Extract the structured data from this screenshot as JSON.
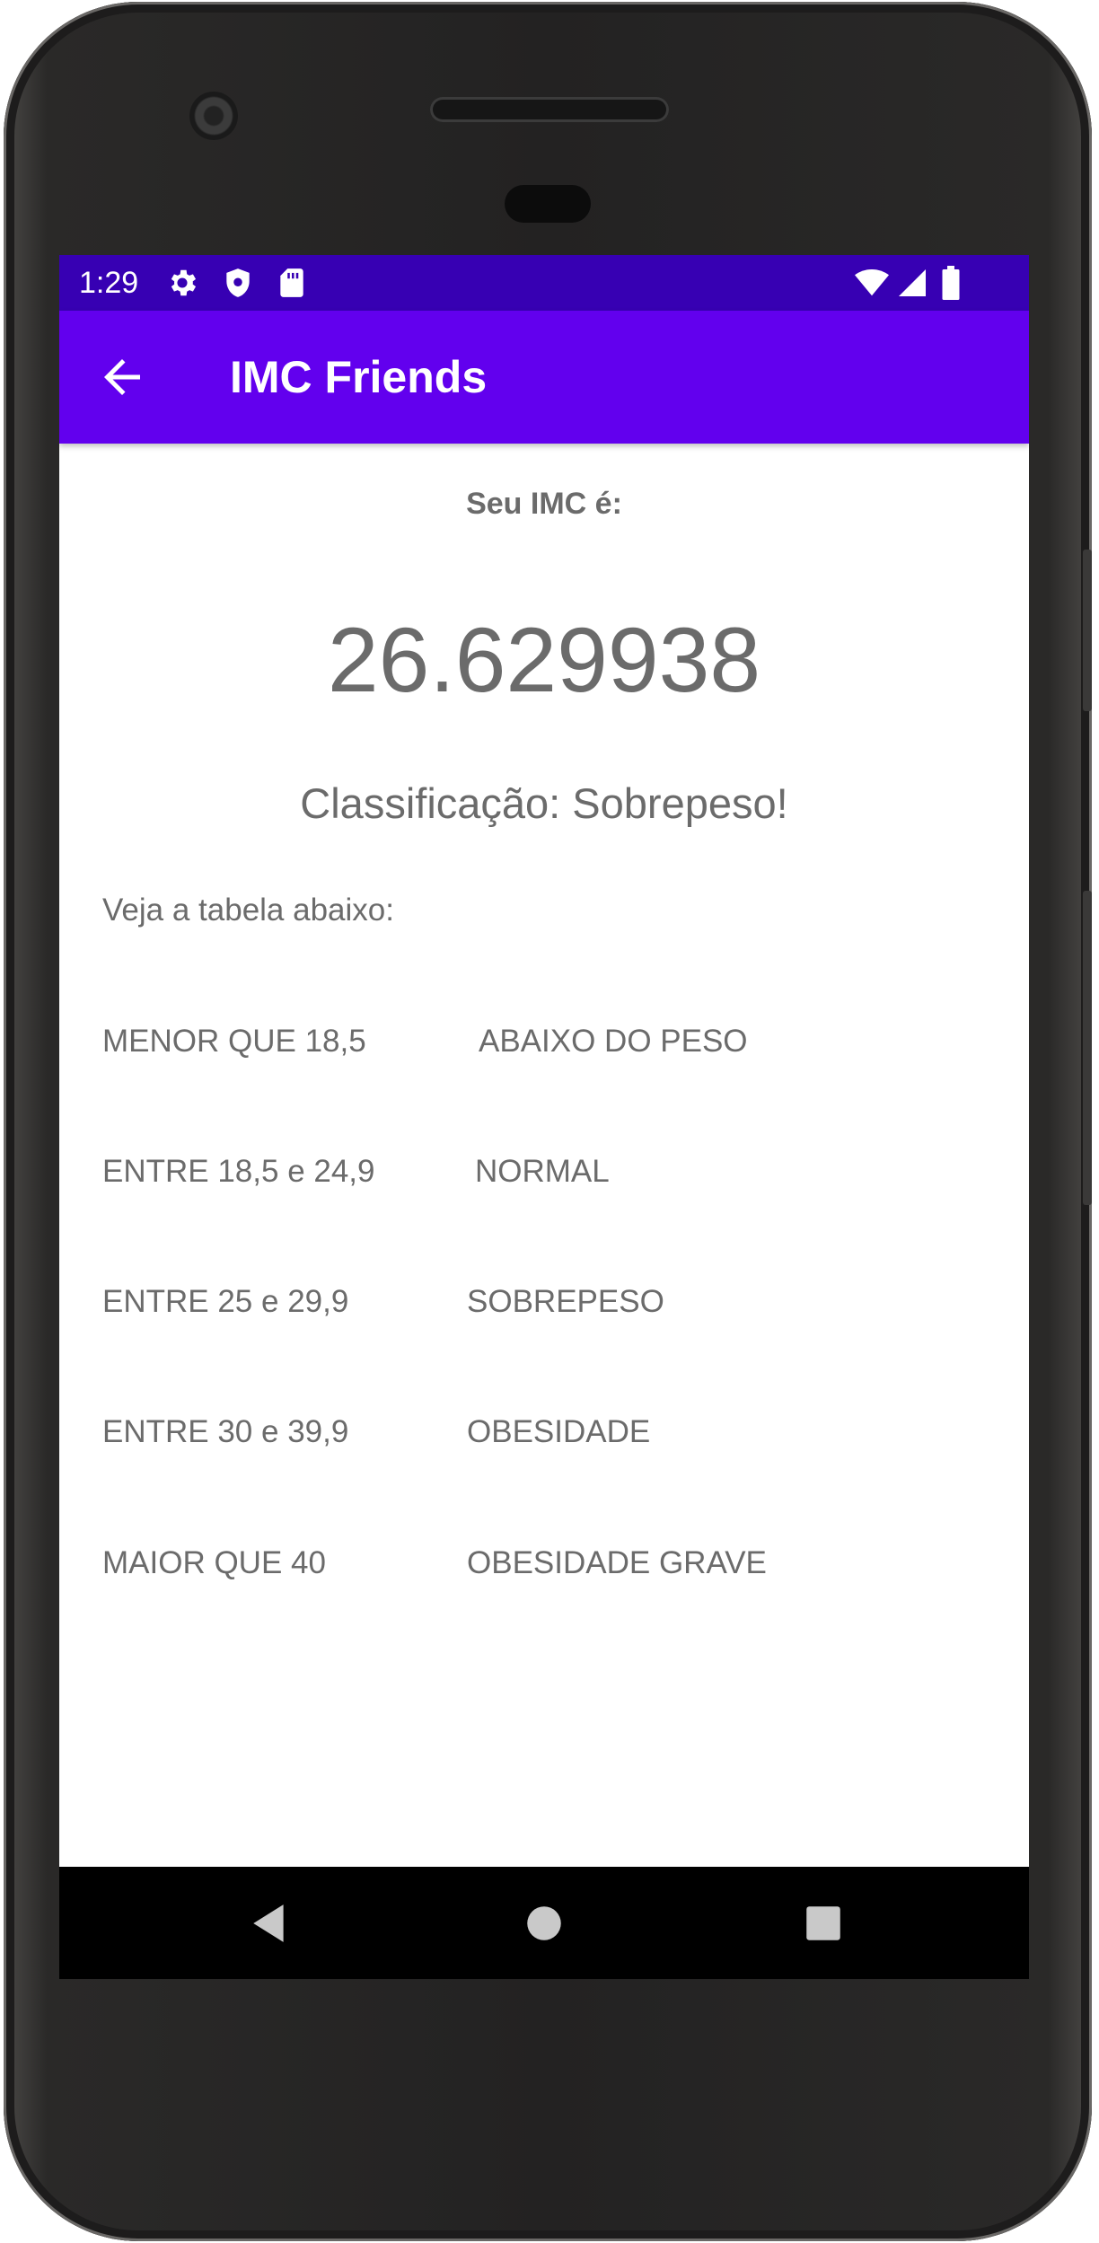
{
  "status_bar": {
    "time": "1:29",
    "left_icons": [
      "gear-icon",
      "shield-icon",
      "sd-card-icon"
    ],
    "right_icons": [
      "wifi-icon",
      "signal-icon",
      "battery-icon"
    ]
  },
  "app_bar": {
    "title": "IMC Friends",
    "back_icon": "arrow-back-icon"
  },
  "result": {
    "heading": "Seu IMC é:",
    "value": "26.629938",
    "classification": "Classificação: Sobrepeso!"
  },
  "table": {
    "intro": "Veja a tabela abaixo:",
    "rows": [
      {
        "range": "MENOR QUE 18,5",
        "class": "ABAIXO DO PESO"
      },
      {
        "range": "ENTRE 18,5 e 24,9",
        "class": "NORMAL"
      },
      {
        "range": "ENTRE 25 e 29,9",
        "class": "SOBREPESO"
      },
      {
        "range": "ENTRE 30 e 39,9",
        "class": "OBESIDADE"
      },
      {
        "range": "MAIOR QUE 40",
        "class": "OBESIDADE GRAVE"
      }
    ]
  },
  "nav_bar": {
    "icons": [
      "back-triangle-icon",
      "home-circle-icon",
      "recents-square-icon"
    ]
  },
  "colors": {
    "status_bar": "#3700b3",
    "app_bar": "#6200ee",
    "text": "#6b6b6b"
  }
}
